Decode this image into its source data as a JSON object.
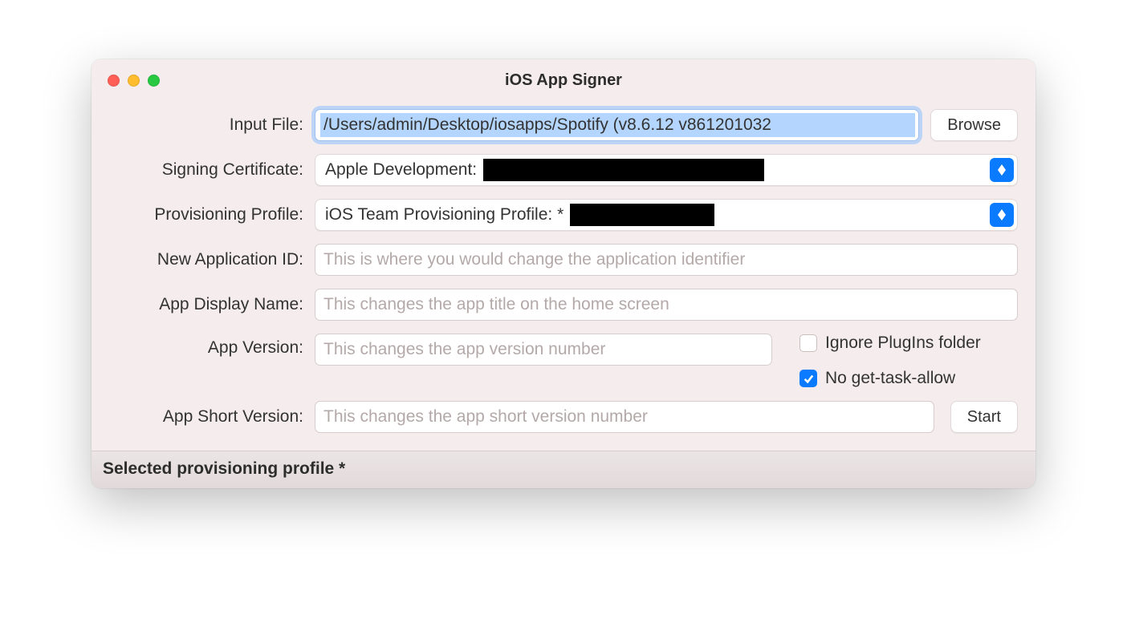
{
  "window": {
    "title": "iOS App Signer"
  },
  "labels": {
    "input_file": "Input File:",
    "signing_certificate": "Signing Certificate:",
    "provisioning_profile": "Provisioning Profile:",
    "new_app_id": "New Application ID:",
    "app_display_name": "App Display Name:",
    "app_version": "App Version:",
    "app_short_version": "App Short Version:"
  },
  "fields": {
    "input_file_value": "/Users/admin/Desktop/iosapps/Spotify (v8.6.12 v861201032",
    "signing_certificate_value": "Apple Development:",
    "provisioning_profile_value": "iOS Team Provisioning Profile: *",
    "new_app_id_value": "",
    "new_app_id_placeholder": "This is where you would change the application identifier",
    "app_display_name_value": "",
    "app_display_name_placeholder": "This changes the app title on the home screen",
    "app_version_value": "",
    "app_version_placeholder": "This changes the app version number",
    "app_short_version_value": "",
    "app_short_version_placeholder": "This changes the app short version number"
  },
  "buttons": {
    "browse": "Browse",
    "start": "Start"
  },
  "checkboxes": {
    "ignore_plugins_label": "Ignore PlugIns folder",
    "ignore_plugins_checked": false,
    "no_get_task_allow_label": "No get-task-allow",
    "no_get_task_allow_checked": true
  },
  "statusbar": "Selected provisioning profile *"
}
